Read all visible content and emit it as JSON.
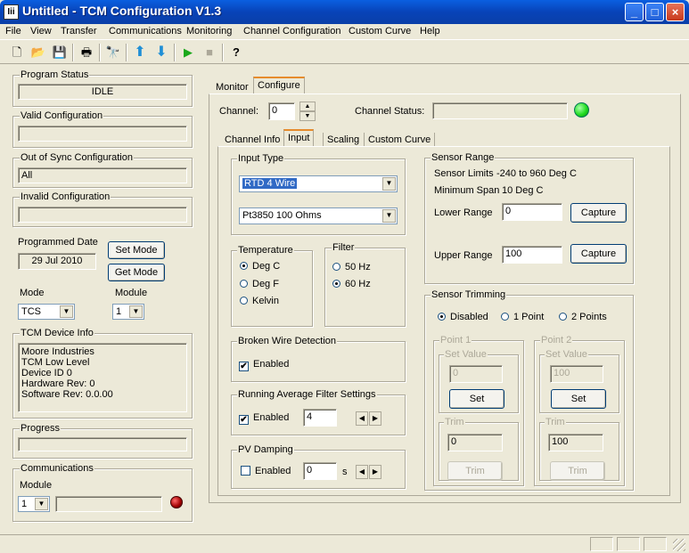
{
  "window": {
    "title": "Untitled - TCM Configuration V1.3",
    "app_icon_text": "Iii",
    "minimize": "_",
    "maximize": "□",
    "close": "×"
  },
  "menu": [
    "File",
    "View",
    "Transfer",
    "Communications",
    "Monitoring",
    "Channel Configuration",
    "Custom Curve",
    "Help"
  ],
  "toolbar": {
    "new": "🗋",
    "open": "📂",
    "save": "💾",
    "print": "🖶",
    "find": "🔭",
    "upload": "⬆",
    "download": "⬇",
    "start": "▶",
    "stop": "■",
    "help": "?"
  },
  "left": {
    "program_status": {
      "label": "Program Status",
      "value": "IDLE"
    },
    "valid_config": {
      "label": "Valid Configuration",
      "value": ""
    },
    "out_of_sync": {
      "label": "Out of Sync Configuration",
      "value": "All"
    },
    "invalid_config": {
      "label": "Invalid Configuration",
      "value": ""
    },
    "programmed_date": {
      "label": "Programmed Date",
      "value": "29 Jul 2010"
    },
    "set_mode": "Set Mode",
    "get_mode": "Get Mode",
    "mode": {
      "label": "Mode",
      "value": "TCS"
    },
    "module": {
      "label": "Module",
      "value": "1"
    },
    "device_info": {
      "label": "TCM Device Info",
      "lines": [
        "Moore Industries",
        "TCM Low Level",
        "Device ID 0",
        "Hardware Rev: 0",
        "Software Rev: 0.0.00"
      ]
    },
    "progress": {
      "label": "Progress"
    },
    "communications": {
      "label": "Communications",
      "module_label": "Module",
      "module_value": "1"
    }
  },
  "tabs_top": [
    "Monitor",
    "Configure"
  ],
  "channel": {
    "label": "Channel:",
    "value": "0",
    "status_label": "Channel Status:",
    "status_value": ""
  },
  "tabs_inner": [
    "Channel Info",
    "Input",
    "Scaling",
    "Custom Curve"
  ],
  "input_type": {
    "label": "Input Type",
    "sensor": "RTD 4 Wire",
    "curve": "Pt3850 100 Ohms"
  },
  "temperature": {
    "label": "Temperature",
    "options": [
      "Deg C",
      "Deg F",
      "Kelvin"
    ],
    "selected": 0
  },
  "filter": {
    "label": "Filter",
    "options": [
      "50 Hz",
      "60 Hz"
    ],
    "selected": 1
  },
  "broken_wire": {
    "label": "Broken Wire Detection",
    "enabled_label": "Enabled",
    "checked": "✔"
  },
  "running_avg": {
    "label": "Running Average Filter Settings",
    "enabled_label": "Enabled",
    "checked": "✔",
    "value": "4"
  },
  "pv_damping": {
    "label": "PV Damping",
    "enabled_label": "Enabled",
    "value": "0",
    "unit": "s"
  },
  "sensor_range": {
    "label": "Sensor Range",
    "limits_label": "Sensor Limits",
    "limits_value": "-240 to 960 Deg C",
    "span_label": "Minimum Span",
    "span_value": "10 Deg C",
    "lower_label": "Lower Range",
    "lower_value": "0",
    "upper_label": "Upper Range",
    "upper_value": "100",
    "capture": "Capture"
  },
  "trimming": {
    "label": "Sensor Trimming",
    "options": [
      "Disabled",
      "1 Point",
      "2 Points"
    ],
    "selected": 0,
    "point1": {
      "label": "Point 1",
      "set_value_label": "Set Value",
      "set_value": "0",
      "set": "Set",
      "trim_label": "Trim",
      "trim_value": "0",
      "trim": "Trim"
    },
    "point2": {
      "label": "Point 2",
      "set_value_label": "Set Value",
      "set_value": "100",
      "set": "Set",
      "trim_label": "Trim",
      "trim_value": "100",
      "trim": "Trim"
    }
  },
  "colors": {
    "status_led": "#22dd22",
    "comm_led": "#aa0000"
  }
}
